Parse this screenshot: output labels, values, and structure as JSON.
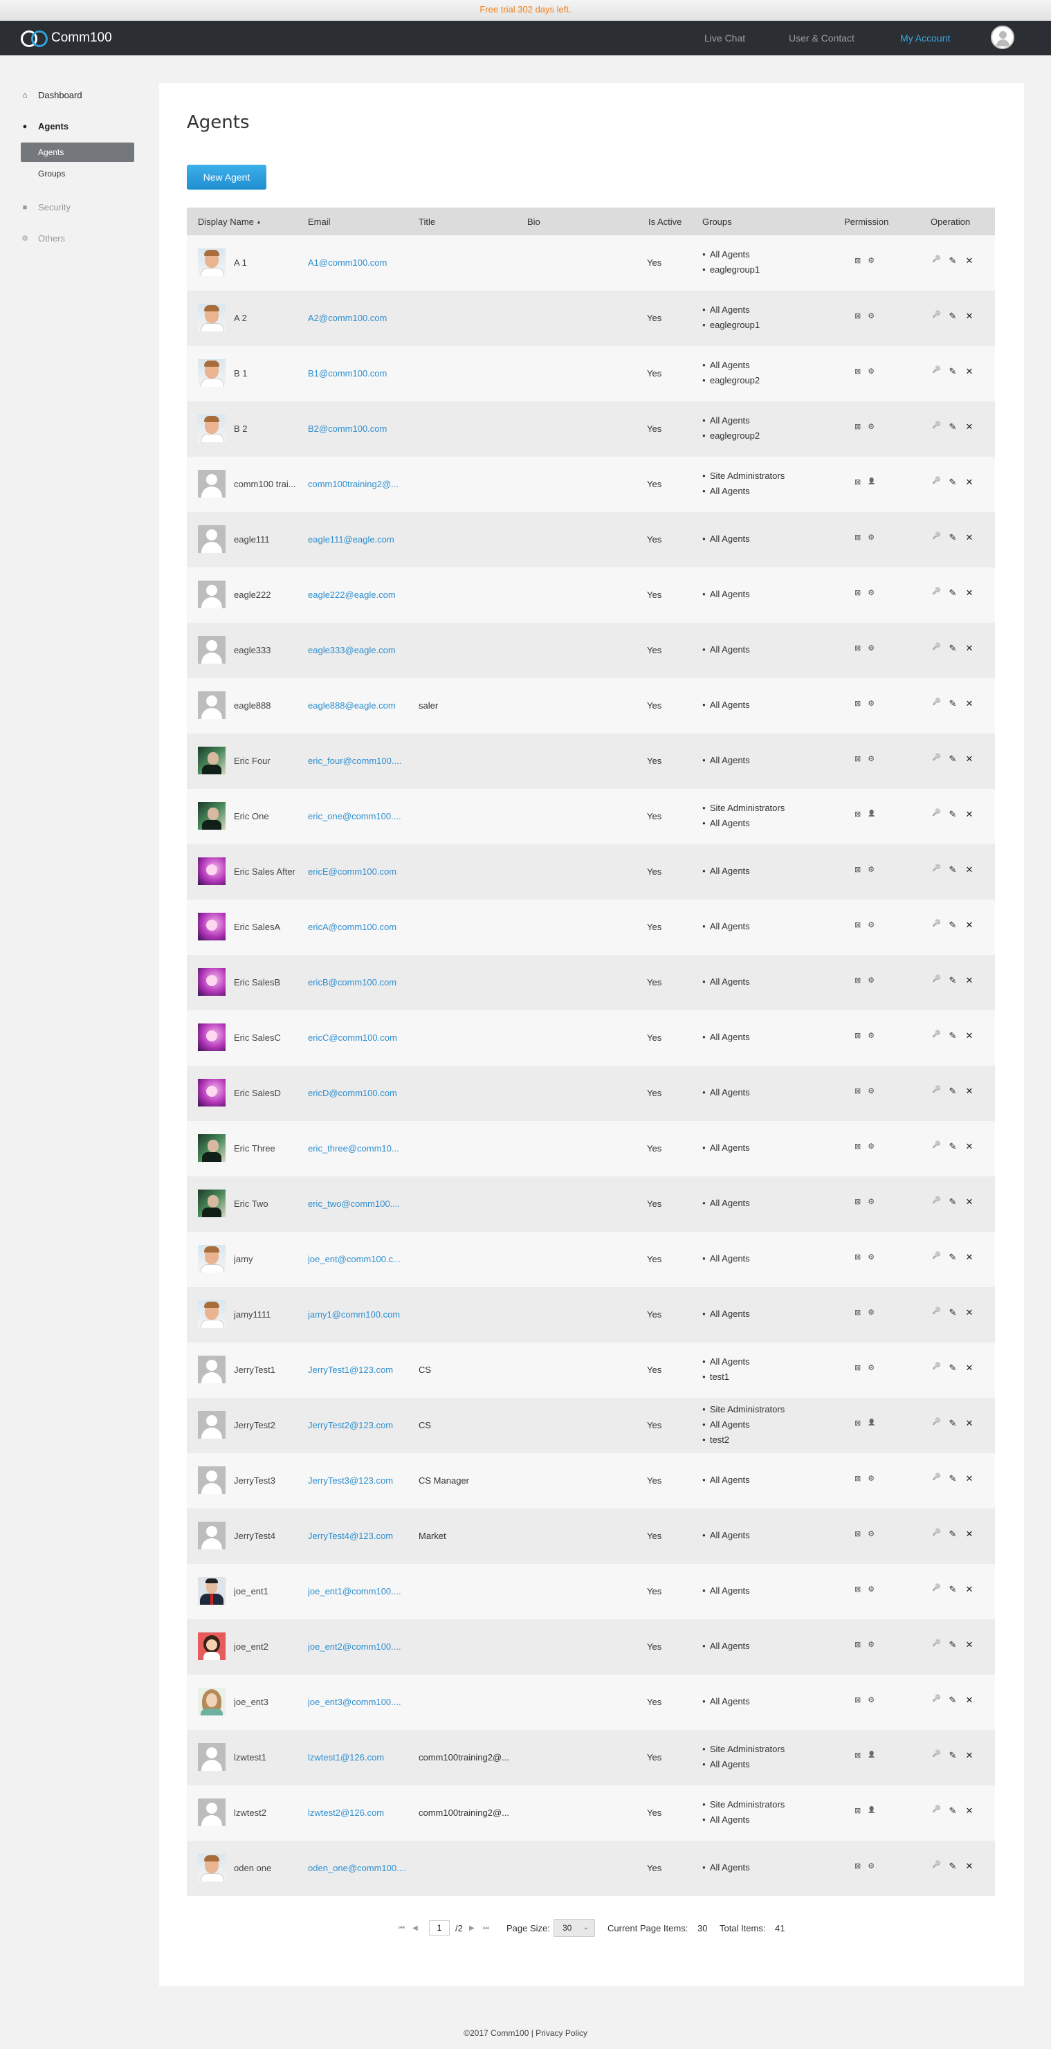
{
  "trial": "Free trial 302 days left.",
  "brand": "Comm100",
  "nav": {
    "live_chat": "Live Chat",
    "user_contact": "User & Contact",
    "my_account": "My Account"
  },
  "sidebar": {
    "dashboard": "Dashboard",
    "agents": "Agents",
    "sub_agents": "Agents",
    "sub_groups": "Groups",
    "security": "Security",
    "others": "Others"
  },
  "page_title": "Agents",
  "new_button": "New Agent",
  "columns": {
    "display_name": "Display Name",
    "email": "Email",
    "title": "Title",
    "bio": "Bio",
    "is_active": "Is Active",
    "groups": "Groups",
    "permission": "Permission",
    "operation": "Operation"
  },
  "icons": {
    "sort": "▲",
    "perm_box": "⊠",
    "perm_gear": "⚙",
    "perm_admin": "👤",
    "op_key": "🔑",
    "op_edit": "✎",
    "op_delete": "✕",
    "first": "⏮",
    "prev": "◀",
    "next": "▶",
    "last": "⏭"
  },
  "agents": [
    {
      "name": "A 1",
      "email": "A1@comm100.com",
      "title": "",
      "bio": "",
      "active": "Yes",
      "groups": [
        "All Agents",
        "eaglegroup1"
      ],
      "admin": false,
      "avatar": "man"
    },
    {
      "name": "A 2",
      "email": "A2@comm100.com",
      "title": "",
      "bio": "",
      "active": "Yes",
      "groups": [
        "All Agents",
        "eaglegroup1"
      ],
      "admin": false,
      "avatar": "man"
    },
    {
      "name": "B 1",
      "email": "B1@comm100.com",
      "title": "",
      "bio": "",
      "active": "Yes",
      "groups": [
        "All Agents",
        "eaglegroup2"
      ],
      "admin": false,
      "avatar": "man"
    },
    {
      "name": "B 2",
      "email": "B2@comm100.com",
      "title": "",
      "bio": "",
      "active": "Yes",
      "groups": [
        "All Agents",
        "eaglegroup2"
      ],
      "admin": false,
      "avatar": "man"
    },
    {
      "name": "comm100 trai...",
      "email": "comm100training2@...",
      "title": "",
      "bio": "",
      "active": "Yes",
      "groups": [
        "Site Administrators",
        "All Agents"
      ],
      "admin": true,
      "avatar": "default"
    },
    {
      "name": "eagle111",
      "email": "eagle111@eagle.com",
      "title": "",
      "bio": "",
      "active": "Yes",
      "groups": [
        "All Agents"
      ],
      "admin": false,
      "avatar": "default"
    },
    {
      "name": "eagle222",
      "email": "eagle222@eagle.com",
      "title": "",
      "bio": "",
      "active": "Yes",
      "groups": [
        "All Agents"
      ],
      "admin": false,
      "avatar": "default"
    },
    {
      "name": "eagle333",
      "email": "eagle333@eagle.com",
      "title": "",
      "bio": "",
      "active": "Yes",
      "groups": [
        "All Agents"
      ],
      "admin": false,
      "avatar": "default"
    },
    {
      "name": "eagle888",
      "email": "eagle888@eagle.com",
      "title": "saler",
      "bio": "",
      "active": "Yes",
      "groups": [
        "All Agents"
      ],
      "admin": false,
      "avatar": "default"
    },
    {
      "name": "Eric Four",
      "email": "eric_four@comm100....",
      "title": "",
      "bio": "",
      "active": "Yes",
      "groups": [
        "All Agents"
      ],
      "admin": false,
      "avatar": "green"
    },
    {
      "name": "Eric One",
      "email": "eric_one@comm100....",
      "title": "",
      "bio": "",
      "active": "Yes",
      "groups": [
        "Site Administrators",
        "All Agents"
      ],
      "admin": true,
      "avatar": "green"
    },
    {
      "name": "Eric Sales After",
      "email": "ericE@comm100.com",
      "title": "",
      "bio": "",
      "active": "Yes",
      "groups": [
        "All Agents"
      ],
      "admin": false,
      "avatar": "purple"
    },
    {
      "name": "Eric SalesA",
      "email": "ericA@comm100.com",
      "title": "",
      "bio": "",
      "active": "Yes",
      "groups": [
        "All Agents"
      ],
      "admin": false,
      "avatar": "purple"
    },
    {
      "name": "Eric SalesB",
      "email": "ericB@comm100.com",
      "title": "",
      "bio": "",
      "active": "Yes",
      "groups": [
        "All Agents"
      ],
      "admin": false,
      "avatar": "purple"
    },
    {
      "name": "Eric SalesC",
      "email": "ericC@comm100.com",
      "title": "",
      "bio": "",
      "active": "Yes",
      "groups": [
        "All Agents"
      ],
      "admin": false,
      "avatar": "purple"
    },
    {
      "name": "Eric SalesD",
      "email": "ericD@comm100.com",
      "title": "",
      "bio": "",
      "active": "Yes",
      "groups": [
        "All Agents"
      ],
      "admin": false,
      "avatar": "purple"
    },
    {
      "name": "Eric Three",
      "email": "eric_three@comm10...",
      "title": "",
      "bio": "",
      "active": "Yes",
      "groups": [
        "All Agents"
      ],
      "admin": false,
      "avatar": "green"
    },
    {
      "name": "Eric Two",
      "email": "eric_two@comm100....",
      "title": "",
      "bio": "",
      "active": "Yes",
      "groups": [
        "All Agents"
      ],
      "admin": false,
      "avatar": "green"
    },
    {
      "name": "jamy",
      "email": "joe_ent@comm100.c...",
      "title": "",
      "bio": "",
      "active": "Yes",
      "groups": [
        "All Agents"
      ],
      "admin": false,
      "avatar": "man"
    },
    {
      "name": "jamy1111",
      "email": "jamy1@comm100.com",
      "title": "",
      "bio": "",
      "active": "Yes",
      "groups": [
        "All Agents"
      ],
      "admin": false,
      "avatar": "man"
    },
    {
      "name": "JerryTest1",
      "email": "JerryTest1@123.com",
      "title": "CS",
      "bio": "",
      "active": "Yes",
      "groups": [
        "All Agents",
        "test1"
      ],
      "admin": false,
      "avatar": "default"
    },
    {
      "name": "JerryTest2",
      "email": "JerryTest2@123.com",
      "title": "CS",
      "bio": "",
      "active": "Yes",
      "groups": [
        "Site Administrators",
        "All Agents",
        "test2"
      ],
      "admin": true,
      "avatar": "default"
    },
    {
      "name": "JerryTest3",
      "email": "JerryTest3@123.com",
      "title": "CS Manager",
      "bio": "",
      "active": "Yes",
      "groups": [
        "All Agents"
      ],
      "admin": false,
      "avatar": "default"
    },
    {
      "name": "JerryTest4",
      "email": "JerryTest4@123.com",
      "title": "Market",
      "bio": "",
      "active": "Yes",
      "groups": [
        "All Agents"
      ],
      "admin": false,
      "avatar": "default"
    },
    {
      "name": "joe_ent1",
      "email": "joe_ent1@comm100....",
      "title": "",
      "bio": "",
      "active": "Yes",
      "groups": [
        "All Agents"
      ],
      "admin": false,
      "avatar": "suit"
    },
    {
      "name": "joe_ent2",
      "email": "joe_ent2@comm100....",
      "title": "",
      "bio": "",
      "active": "Yes",
      "groups": [
        "All Agents"
      ],
      "admin": false,
      "avatar": "girl"
    },
    {
      "name": "joe_ent3",
      "email": "joe_ent3@comm100....",
      "title": "",
      "bio": "",
      "active": "Yes",
      "groups": [
        "All Agents"
      ],
      "admin": false,
      "avatar": "woman"
    },
    {
      "name": "lzwtest1",
      "email": "lzwtest1@126.com",
      "title": "comm100training2@...",
      "bio": "",
      "active": "Yes",
      "groups": [
        "Site Administrators",
        "All Agents"
      ],
      "admin": true,
      "avatar": "default"
    },
    {
      "name": "lzwtest2",
      "email": "lzwtest2@126.com",
      "title": "comm100training2@...",
      "bio": "",
      "active": "Yes",
      "groups": [
        "Site Administrators",
        "All Agents"
      ],
      "admin": true,
      "avatar": "default"
    },
    {
      "name": "oden one",
      "email": "oden_one@comm100....",
      "title": "",
      "bio": "",
      "active": "Yes",
      "groups": [
        "All Agents"
      ],
      "admin": false,
      "avatar": "man"
    }
  ],
  "pager": {
    "page": "1",
    "total_pages": "/2",
    "page_size_label": "Page Size:",
    "page_size": "30",
    "current_label": "Current Page Items:",
    "current_count": "30",
    "total_label": "Total Items:",
    "total_count": "41"
  },
  "footer": "©2017 Comm100 | Privacy Policy",
  "colors": {
    "accent": "#2e8fcf",
    "trial": "#f07f1a",
    "nav": "#2b2e33"
  }
}
